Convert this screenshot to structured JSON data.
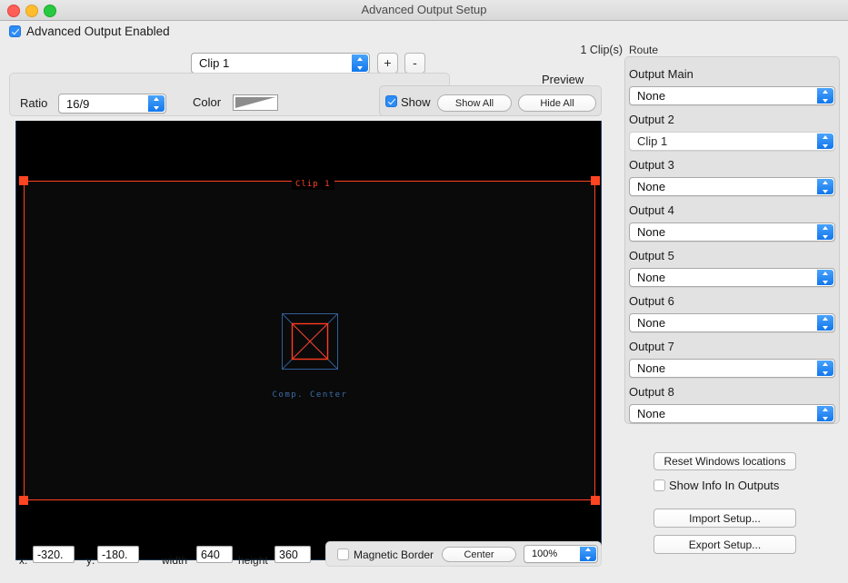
{
  "window": {
    "title": "Advanced Output Setup",
    "traffic_lights": [
      "close-button",
      "minimize-button",
      "maximize-button"
    ]
  },
  "header": {
    "enabled_checkbox_label": "Advanced Output Enabled",
    "enabled_checked": true,
    "clip_count": "1 Clip(s)",
    "clip_selector_value": "Clip 1",
    "add_button": "+",
    "remove_button": "-"
  },
  "settings": {
    "ratio_label": "Ratio",
    "ratio_value": "16/9",
    "color_label": "Color"
  },
  "preview": {
    "group_label": "Preview",
    "show_label": "Show",
    "show_checked": true,
    "show_all_button": "Show All",
    "hide_all_button": "Hide All"
  },
  "canvas": {
    "clip_tag": "Clip 1",
    "comp_center_label": "Comp. Center",
    "frame_color": "#ff4422",
    "center_marker_outer_color": "#2f5f96",
    "center_marker_inner_color": "#ff3b20",
    "background": "#000000",
    "clip_fill": "#0a0a0a"
  },
  "bottom": {
    "x_label": "x:",
    "x_value": "-320.",
    "y_label": "y:",
    "y_value": "-180.",
    "width_label": "width",
    "width_value": "640",
    "height_label": "height",
    "height_value": "360",
    "magnetic_border_label": "Magnetic Border",
    "magnetic_border_checked": false,
    "center_button": "Center",
    "zoom_value": "100%"
  },
  "route": {
    "group_label": "Route",
    "outputs": [
      {
        "label": "Output Main",
        "value": "None",
        "dim": false
      },
      {
        "label": "Output 2",
        "value": "Clip 1",
        "dim": true
      },
      {
        "label": "Output 3",
        "value": "None",
        "dim": false
      },
      {
        "label": "Output 4",
        "value": "None",
        "dim": false
      },
      {
        "label": "Output 5",
        "value": "None",
        "dim": false
      },
      {
        "label": "Output 6",
        "value": "None",
        "dim": false
      },
      {
        "label": "Output 7",
        "value": "None",
        "dim": false
      },
      {
        "label": "Output 8",
        "value": "None",
        "dim": false
      }
    ],
    "reset_windows_button": "Reset Windows locations",
    "show_info_label": "Show Info In Outputs",
    "show_info_checked": false,
    "import_button": "Import Setup...",
    "export_button": "Export Setup..."
  }
}
